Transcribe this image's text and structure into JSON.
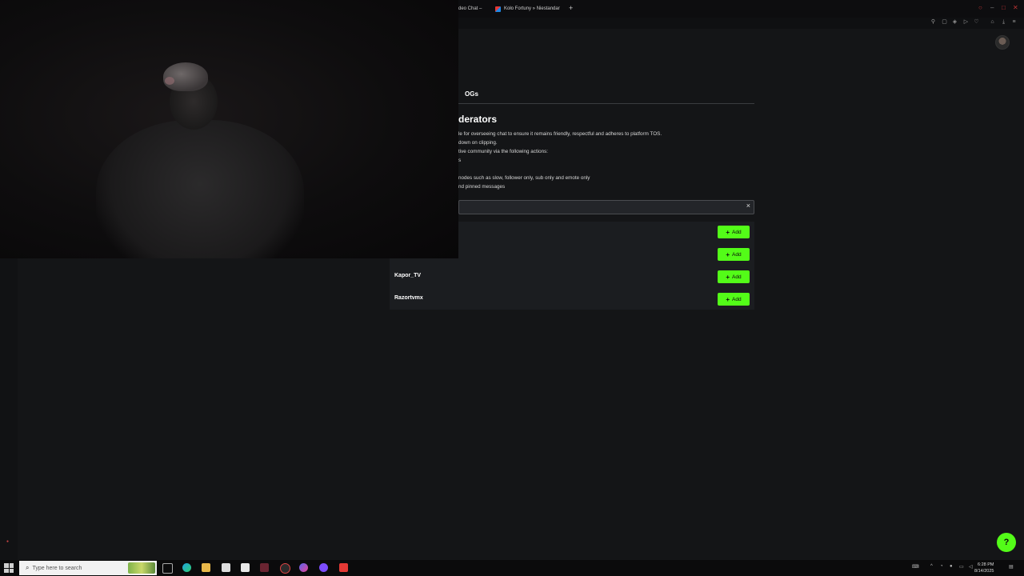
{
  "browser": {
    "tabs": [
      {
        "label": "deo Chat –"
      },
      {
        "label": "Koło Fortuny » Niestandar"
      }
    ],
    "new_tab_icon": "plus-icon"
  },
  "page": {
    "tabs": [
      {
        "label": "OGs"
      }
    ],
    "section_title": "derators",
    "description_lines": [
      "le for overseeing chat to ensure it remains friendly, respectful and adheres to platform TOS.",
      "down on clipping.",
      "tive community via the following actions:",
      "s",
      "nodes such as slow, follower only, sub only and emote only",
      "nd pinned messages"
    ],
    "search": {
      "value": "",
      "clear_icon": "×"
    },
    "list": [
      {
        "name": "",
        "add_label": "Add"
      },
      {
        "name": "",
        "add_label": "Add"
      },
      {
        "name": "Kapor_TV",
        "add_label": "Add"
      },
      {
        "name": "Razortvmx",
        "add_label": "Add"
      }
    ],
    "accent_color": "#53fc18"
  },
  "taskbar": {
    "search_placeholder": "Type here to search",
    "time": "6:28 PM",
    "date": "8/14/2025"
  }
}
